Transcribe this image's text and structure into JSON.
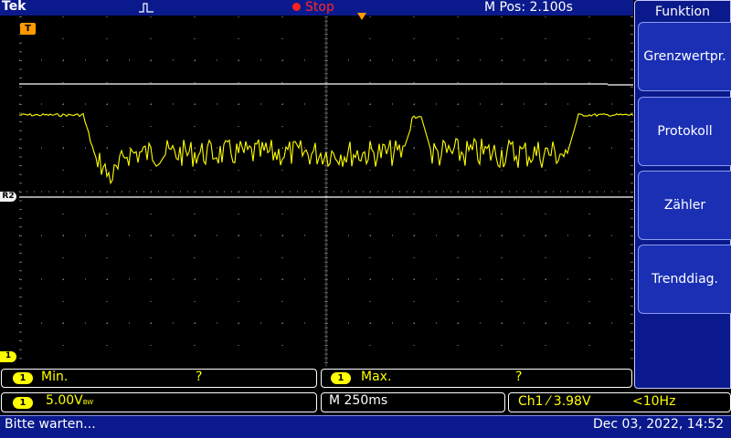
{
  "header": {
    "brand": "Tek",
    "acquisition_state": "Stop",
    "m_pos": "M Pos: 2.100s"
  },
  "markers": {
    "trigger": "T",
    "ref": "R2",
    "channel": "1"
  },
  "menu": {
    "title": "Funktion",
    "items": [
      {
        "label": "Grenzwertpr."
      },
      {
        "label": "Protokoll"
      },
      {
        "label": "Zähler"
      },
      {
        "label": "Trenddiag."
      }
    ]
  },
  "measurements": {
    "min": {
      "channel": "1",
      "label": "Min.",
      "value": "?"
    },
    "max": {
      "channel": "1",
      "label": "Max.",
      "value": "?"
    }
  },
  "settings": {
    "channel": "1",
    "vertical_scale": "5.00V",
    "bandwidth_mark": "BW",
    "timebase": "M 250ms",
    "trigger": "Ch1 ⁄ 3.98V",
    "freq": "<10Hz"
  },
  "status": {
    "message": "Bitte warten...",
    "datetime": "Dec 03, 2022, 14:52"
  },
  "colors": {
    "ch1": "#ffff00",
    "ref": "#ffffff",
    "frame": "#0a1a8c",
    "stop": "#ff2a2a"
  }
}
